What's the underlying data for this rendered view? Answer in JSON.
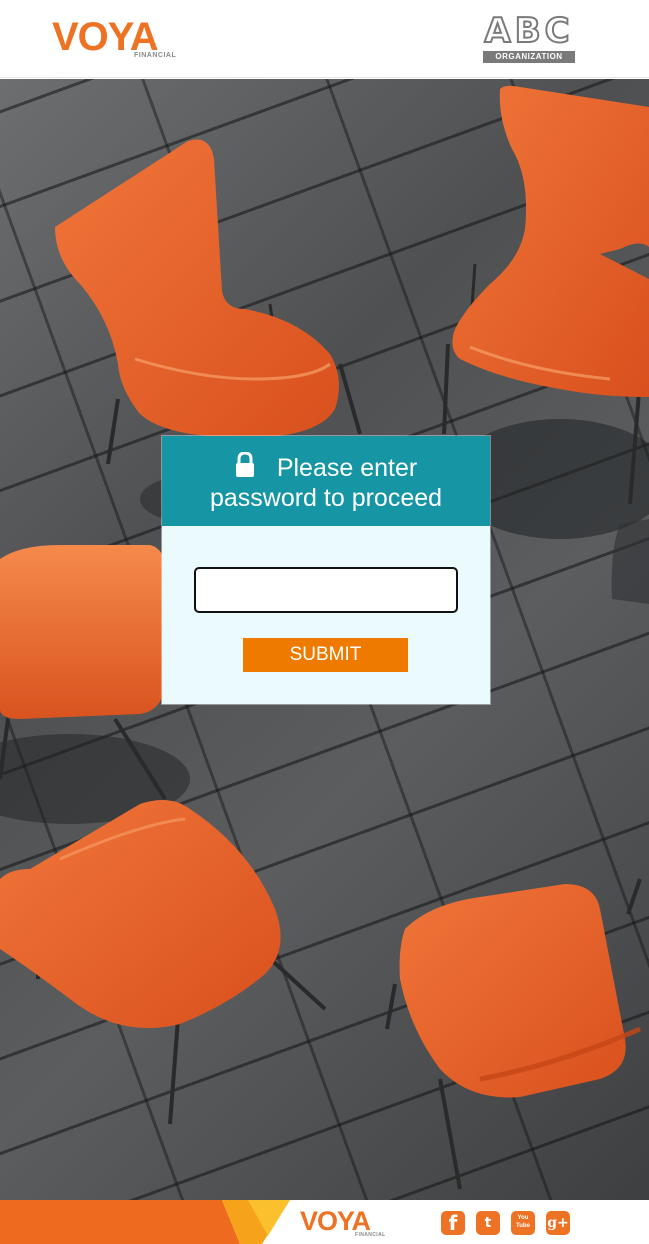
{
  "header": {
    "brand_logo_text": "VOYA",
    "brand_logo_subtext": "FINANCIAL",
    "org_logo_text": "ABC",
    "org_logo_subtext": "ORGANIZATION"
  },
  "login": {
    "title_line_1": "Please enter",
    "title_line_2": "password to proceed",
    "lock_icon": "lock-icon",
    "password_value": "",
    "submit_label": "SUBMIT"
  },
  "footer": {
    "brand_logo_text": "VOYA",
    "brand_logo_subtext": "FINANCIAL",
    "social": [
      {
        "name": "facebook-icon",
        "glyph": "f"
      },
      {
        "name": "twitter-icon",
        "glyph": "t"
      },
      {
        "name": "youtube-icon",
        "glyph_top": "You",
        "glyph_bottom": "Tube"
      },
      {
        "name": "google-plus-icon",
        "glyph": "g+"
      }
    ]
  },
  "colors": {
    "brand_orange": "#ee7223",
    "button_orange": "#ee7a00",
    "teal_header": "#1695a5",
    "card_background": "#eafafd",
    "chair_orange": "#e8602a",
    "floor_gray": "#545658"
  }
}
